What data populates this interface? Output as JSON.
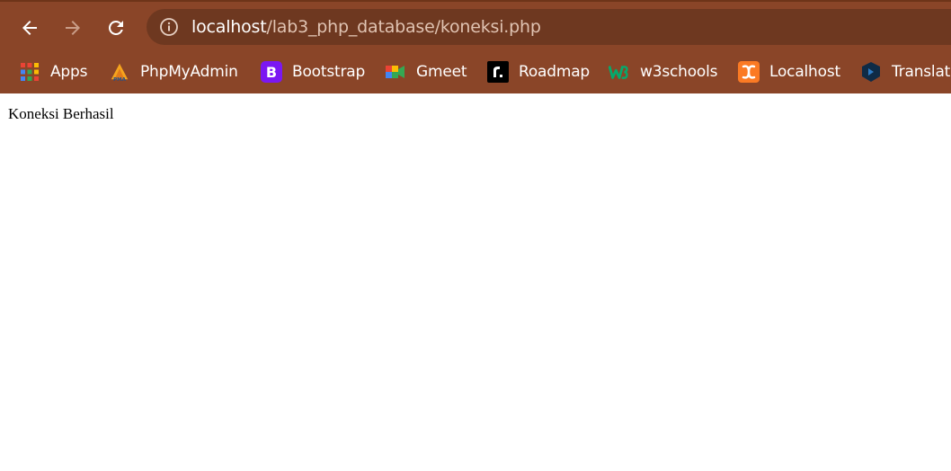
{
  "browser": {
    "address_bar": {
      "host": "localhost",
      "path": "/lab3_php_database/koneksi.php"
    },
    "bookmarks": [
      {
        "label": "Apps",
        "icon": "apps-grid-icon"
      },
      {
        "label": "PhpMyAdmin",
        "icon": "phpmyadmin-icon"
      },
      {
        "label": "Bootstrap",
        "icon": "bootstrap-icon"
      },
      {
        "label": "Gmeet",
        "icon": "gmeet-icon"
      },
      {
        "label": "Roadmap",
        "icon": "roadmap-icon"
      },
      {
        "label": "w3schools",
        "icon": "w3schools-icon"
      },
      {
        "label": "Localhost",
        "icon": "xampp-icon"
      },
      {
        "label": "Translate",
        "icon": "translate-icon"
      }
    ],
    "colors": {
      "chrome_bg": "#8a4528",
      "omnibox_bg": "#6e3820",
      "bootstrap_purple": "#7b17f2",
      "w3schools_green": "#04aa6d",
      "xampp_orange": "#fb7a24"
    }
  },
  "page": {
    "message": "Koneksi Berhasil"
  }
}
